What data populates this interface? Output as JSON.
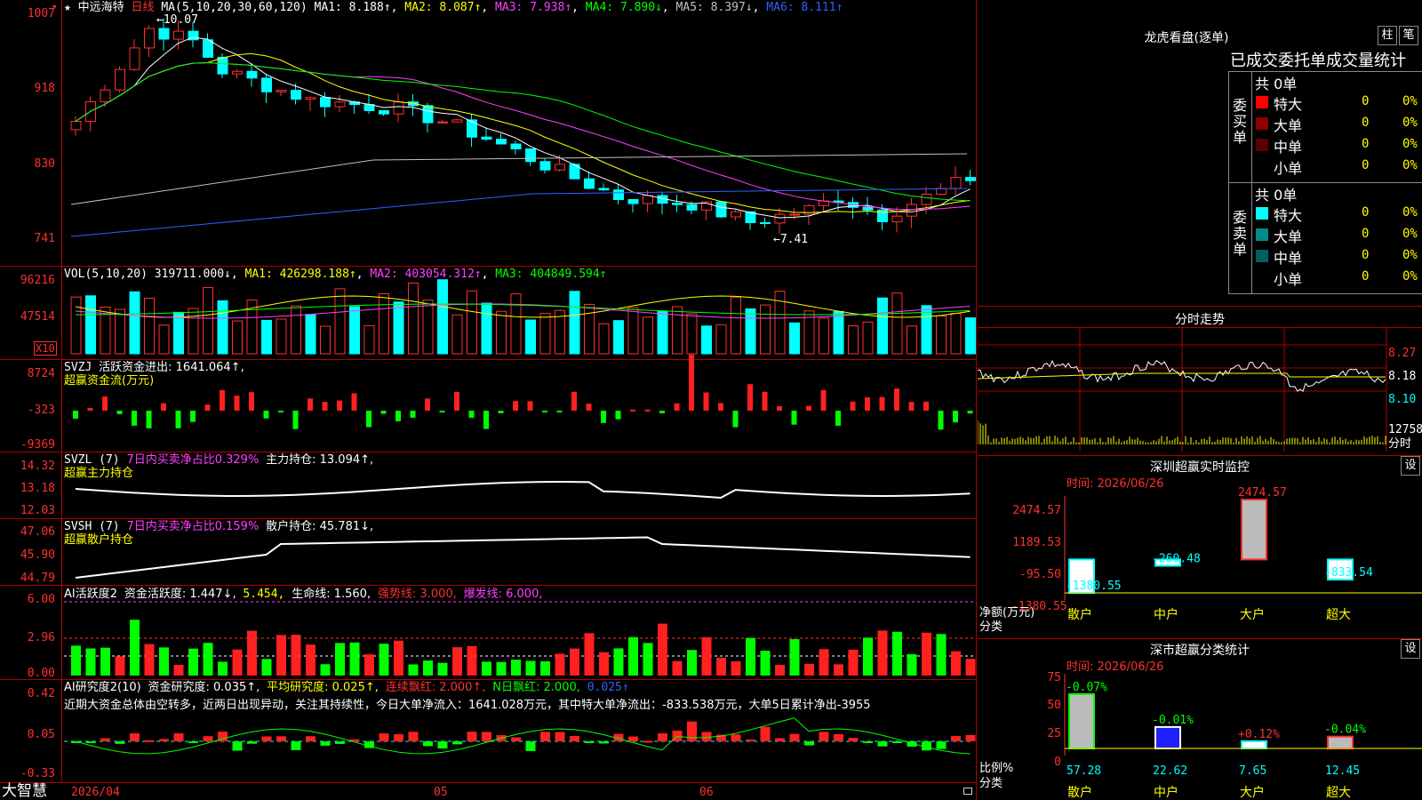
{
  "stock": {
    "name": "中远海特",
    "period": "日线",
    "star": "★",
    "menu_arrow": "▾"
  },
  "kline": {
    "ma_title": "MA(5,10,20,30,60,120)",
    "ma1": "MA1: 8.188↑",
    "ma2": "MA2: 8.087↑",
    "ma3": "MA3: 7.938↑",
    "ma4": "MA4: 7.890↓",
    "ma5": "MA5: 8.397↓",
    "ma6": "MA6: 8.111↑",
    "axis": [
      "1007",
      "918",
      "830",
      "741"
    ],
    "high_label": "10.07",
    "low_label": "7.41",
    "colors": {
      "ma1": "#ffffff",
      "ma2": "#ffff00",
      "ma3": "#ff40ff",
      "ma4": "#00ff00",
      "ma5": "#c0c0c0",
      "ma6": "#3060ff"
    }
  },
  "volume": {
    "title": "VOL(5,10,20)",
    "value": "319711.000↓",
    "ma1": "MA1: 426298.188↑",
    "ma2": "MA2: 403054.312↑",
    "ma3": "MA3: 404849.594↑",
    "axis": [
      "96216",
      "47514"
    ],
    "unit": "X10"
  },
  "svzj": {
    "title": "SVZJ",
    "desc": "活跃资金进出: 1641.064↑,",
    "sub": "超赢资金流(万元)",
    "axis": [
      "8724",
      "-323",
      "-9369"
    ]
  },
  "svzl": {
    "title": "SVZL (7)",
    "desc1": "7日内买卖净占比0.329%",
    "desc2": "主力持仓: 13.094↑,",
    "sub": "超赢主力持仓",
    "axis": [
      "14.32",
      "13.18",
      "12.03"
    ]
  },
  "svsh": {
    "title": "SVSH (7)",
    "desc1": "7日内买卖净占比0.159%",
    "desc2": "散户持仓: 45.781↓,",
    "sub": "超赢散户持仓",
    "axis": [
      "47.06",
      "45.90",
      "44.79"
    ]
  },
  "ai_active": {
    "title": "AI活跃度2",
    "a": "资金活跃度: 1.447↓,",
    "b": "5.454,",
    "c": "生命线: 1.560,",
    "d": "强势线: 3.000,",
    "e": "爆发线: 6.000,",
    "axis": [
      "6.00",
      "2.96",
      "0.00"
    ]
  },
  "ai_research": {
    "title": "AI研究度2(10)",
    "a": "资金研究度: 0.035↑,",
    "b": "平均研究度: 0.025↑,",
    "c": "连续飘红: 2.000↑,",
    "d": "N日飘红: 2.000,",
    "e": "0.025↑",
    "comment": "近期大资金总体由空转多，近两日出现异动，关注其持续性，今日大单净流入：1641.028万元，其中特大单净流出：-833.538万元，大单5日累计净出-3955",
    "axis": [
      "0.42",
      "0.05",
      "-0.33"
    ]
  },
  "bottom": {
    "brand": "大智慧",
    "date_start": "2026/04",
    "m05": "05",
    "m06": "06"
  },
  "lhb": {
    "title": "龙虎看盘(逐单)",
    "btn_zhu": "柱",
    "btn_bi": "笔",
    "subtitle": "已成交委托单成交量统计",
    "buy": {
      "label": "委买单",
      "total": "共 0单",
      "rows": [
        {
          "name": "特大",
          "count": "0",
          "pct": "0%",
          "color": "#ff0000"
        },
        {
          "name": "大单",
          "count": "0",
          "pct": "0%",
          "color": "#8b0000"
        },
        {
          "name": "中单",
          "count": "0",
          "pct": "0%",
          "color": "#5a0000"
        },
        {
          "name": "小单",
          "count": "0",
          "pct": "0%",
          "color": ""
        }
      ]
    },
    "sell": {
      "label": "委卖单",
      "total": "共 0单",
      "rows": [
        {
          "name": "特大",
          "count": "0",
          "pct": "0%",
          "color": "#00ffff"
        },
        {
          "name": "大单",
          "count": "0",
          "pct": "0%",
          "color": "#008b8b"
        },
        {
          "name": "中单",
          "count": "0",
          "pct": "0%",
          "color": "#006060"
        },
        {
          "name": "小单",
          "count": "0",
          "pct": "0%",
          "color": ""
        }
      ]
    }
  },
  "intraday": {
    "title": "分时走势",
    "axis": [
      "8.27",
      "8.18",
      "8.10",
      "12758"
    ],
    "unit": "分时"
  },
  "sz_monitor": {
    "title": "深圳超赢实时监控",
    "btn": "设",
    "time": "时间: 2026/06/26",
    "axis": [
      "2474.57",
      "1189.53",
      "-95.50",
      "-1380.55"
    ],
    "ylabel": "净额(万元)",
    "xlabel": "分类",
    "chart_data": {
      "type": "bar",
      "categories": [
        "散户",
        "中户",
        "大户",
        "超大"
      ],
      "values": [
        -1380.55,
        -260.48,
        2474.57,
        -833.54
      ],
      "ylim": [
        -1380.55,
        2474.57
      ]
    }
  },
  "sz_stats": {
    "title": "深市超赢分类统计",
    "btn": "设",
    "time": "时间: 2026/06/26",
    "axis": [
      "75",
      "50",
      "25",
      "0"
    ],
    "ylabel": "比例%",
    "xlabel": "分类",
    "chart_data": {
      "type": "bar",
      "categories": [
        "散户",
        "中户",
        "大户",
        "超大"
      ],
      "values": [
        57.28,
        22.62,
        7.65,
        12.45
      ],
      "changes": [
        "-0.07%",
        "-0.01%",
        "+0.12%",
        "-0.04%"
      ],
      "ylim": [
        0,
        75
      ]
    }
  }
}
